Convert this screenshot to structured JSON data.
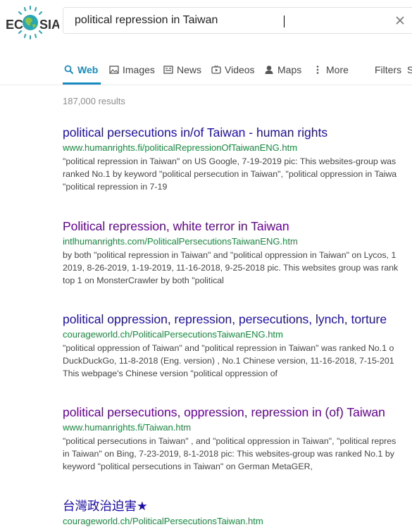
{
  "brand": {
    "logo_text": "ECOSIA"
  },
  "search": {
    "query": "political repression in Taiwan",
    "clear_label": "×"
  },
  "tabs": [
    {
      "label": "Web",
      "icon": "search-icon",
      "active": true
    },
    {
      "label": "Images",
      "icon": "image-icon"
    },
    {
      "label": "News",
      "icon": "news-icon"
    },
    {
      "label": "Videos",
      "icon": "video-icon"
    },
    {
      "label": "Maps",
      "icon": "map-pin-icon"
    },
    {
      "label": "More",
      "icon": "more-dots-icon"
    },
    {
      "label": "Filters"
    },
    {
      "label": "S"
    }
  ],
  "results_count": "187,000 results",
  "results": [
    {
      "title": "political persecutions in/of Taiwan - human rights",
      "url": "www.humanrights.fi/politicalRepressionOfTaiwanENG.htm",
      "snippet": [
        "\"political repression in Taiwan\" on US Google, 7-19-2019 pic: This websites-group was",
        "ranked No.1 by keyword \"political persecution in Taiwan\", \"political oppression in Taiwa",
        "\"political repression in 7-19"
      ]
    },
    {
      "title": "Political repression, white terror in Taiwan",
      "url": "intlhumanrights.com/PoliticalPersecutionsTaiwanENG.htm",
      "snippet": [
        "by both \"political repression in Taiwan\" and \"political oppression in Taiwan\" on Lycos, 1",
        "2019, 8-26-2019, 1-19-2019, 11-16-2018, 9-25-2018 pic. This websites group was rank",
        "top 1 on MonsterCrawler by both \"political"
      ]
    },
    {
      "title": "political oppression, repression, persecutions, lynch, torture",
      "url": "courageworld.ch/PoliticalPersecutionsTaiwanENG.htm",
      "snippet": [
        "\"political oppression of Taiwan\" and \"political repression in Taiwan\" was ranked No.1 o",
        "DuckDuckGo, 11-8-2018 (Eng. version) , No.1 Chinese version, 11-16-2018, 7-15-201",
        "This webpage's Chinese version \"political oppression of"
      ]
    },
    {
      "title": "political persecutions, oppression, repression in (of) Taiwan",
      "url": "www.humanrights.fi/Taiwan.htm",
      "snippet": [
        "\"political persecutions in Taiwan\" , and \"political oppression in Taiwan\", \"political repres",
        "in Taiwan\" on Bing, 7-23-2019, 8-1-2018 pic: This websites-group was ranked No.1 by",
        "keyword \"political persecutions in Taiwan\" on German MetaGER,"
      ]
    },
    {
      "title": "台灣政治迫害★",
      "url": "courageworld.ch/PoliticalPersecutionsTaiwan.htm",
      "snippet": []
    }
  ],
  "colors": {
    "link": "#1a0dab",
    "visited": "#660099",
    "url_green": "#178d3e",
    "tab_active": "#1a8bc1"
  }
}
